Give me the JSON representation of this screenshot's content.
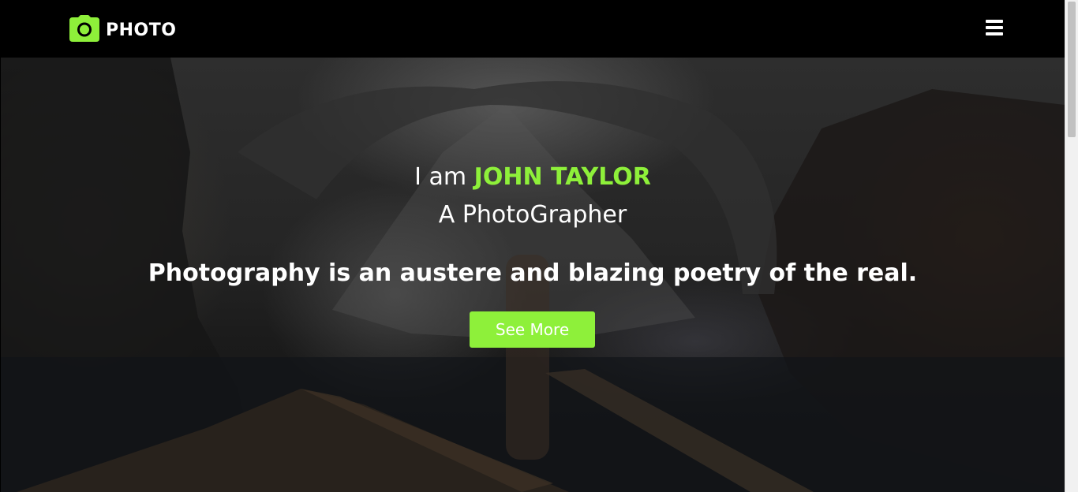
{
  "colors": {
    "accent": "#8ef03a",
    "navbar_bg": "#000000",
    "text": "#ffffff"
  },
  "navbar": {
    "logo_icon": "camera-icon",
    "logo_text": "PHOTO",
    "menu_icon": "hamburger-menu-icon"
  },
  "hero": {
    "intro_prefix": "I am ",
    "name": "JOHN TAYLOR",
    "role": "A PhotoGrapher",
    "quote": "Photography is an austere and blazing poetry of the real.",
    "button_label": "See More"
  }
}
